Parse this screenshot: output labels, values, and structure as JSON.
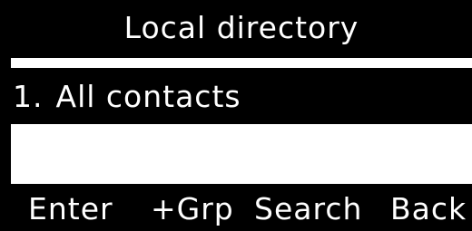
{
  "title": "Local directory",
  "list": {
    "items": [
      {
        "number": "1.",
        "label": "All contacts"
      }
    ]
  },
  "softkeys": {
    "enter": "Enter",
    "add_group": "+Grp",
    "search": "Search",
    "back": "Back"
  },
  "colors": {
    "background": "#000000",
    "lcd": "#ffffff",
    "highlight": "#000000",
    "text_on_dark": "#ffffff"
  }
}
